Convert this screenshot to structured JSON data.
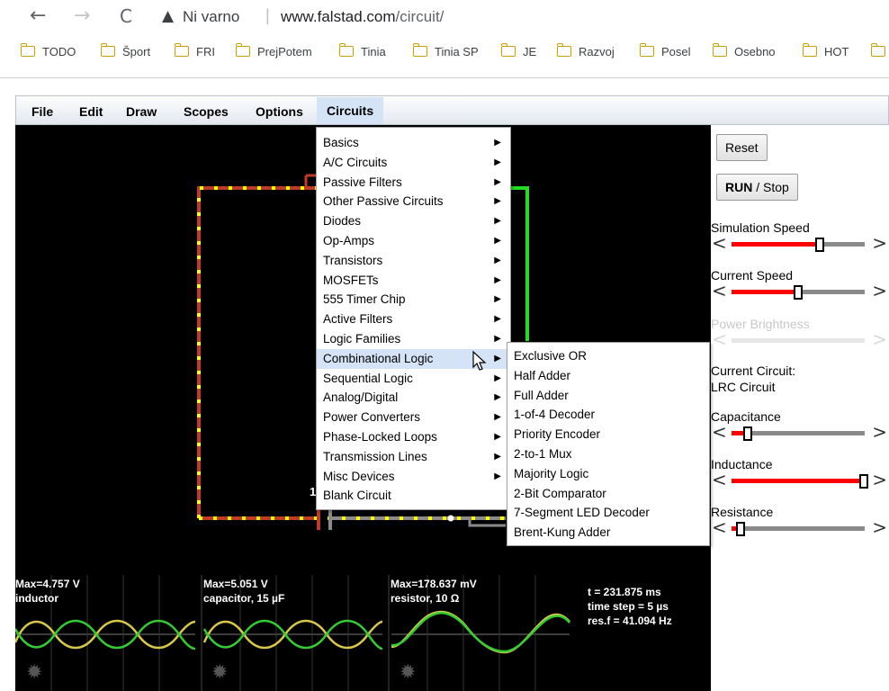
{
  "browser": {
    "back_glyph": "←",
    "forward_glyph": "→",
    "reload_glyph": "C",
    "security_glyph": "▲",
    "security_text": "Ni varno",
    "separator": "|",
    "url_host": "www.falstad.com",
    "url_path": "/circuit/",
    "bookmarks": [
      {
        "label": "TODO"
      },
      {
        "label": "Šport"
      },
      {
        "label": "FRI"
      },
      {
        "label": "PrejPotem"
      },
      {
        "label": "Tinia"
      },
      {
        "label": "Tinia SP"
      },
      {
        "label": "JE"
      },
      {
        "label": "Razvoj"
      },
      {
        "label": "Posel"
      },
      {
        "label": "Osebno"
      },
      {
        "label": "HOT"
      }
    ]
  },
  "menubar": {
    "file": "File",
    "edit": "Edit",
    "draw": "Draw",
    "scopes": "Scopes",
    "options": "Options",
    "circuits": "Circuits"
  },
  "circuits_menu": [
    "Basics",
    "A/C Circuits",
    "Passive Filters",
    "Other Passive Circuits",
    "Diodes",
    "Op-Amps",
    "Transistors",
    "MOSFETs",
    "555 Timer Chip",
    "Active Filters",
    "Logic Families",
    "Combinational Logic",
    "Sequential Logic",
    "Analog/Digital",
    "Power Converters",
    "Phase-Locked Loops",
    "Transmission Lines",
    "Misc Devices",
    "Blank Circuit"
  ],
  "combinational_menu": [
    "Exclusive OR",
    "Half Adder",
    "Full Adder",
    "1-of-4 Decoder",
    "Priority Encoder",
    "2-to-1 Mux",
    "Majority Logic",
    "2-Bit Comparator",
    "7-Segment LED Decoder",
    "Brent-Kung Adder"
  ],
  "sidebar": {
    "reset": "Reset",
    "run": "RUN",
    "stop": " / Stop",
    "sim_speed_label": "Simulation Speed",
    "sim_speed_level": 0.66,
    "current_speed_label": "Current Speed",
    "current_speed_level": 0.5,
    "power_brightness_label": "Power Brightness",
    "current_circuit_label": "Current Circuit:",
    "current_circuit_name": "LRC Circuit",
    "capacitance_label": "Capacitance",
    "capacitance_level": 0.12,
    "inductance_label": "Inductance",
    "inductance_level": 0.99,
    "resistance_label": "Resistance",
    "resistance_level": 0.07,
    "lt": "<",
    "gt": ">"
  },
  "scopes": [
    {
      "max": "Max=4.757 V",
      "name": "inductor"
    },
    {
      "max": "Max=5.051 V",
      "name": "capacitor, 15 µF"
    },
    {
      "max": "Max=178.637 mV",
      "name": "resistor, 10 Ω"
    }
  ],
  "sim_info": {
    "time": "t = 231.875 ms",
    "step": "time step = 5 µs",
    "resf": "res.f = 41.094 Hz"
  },
  "circuit_fragment_label": "1",
  "colors": {
    "wire_red": "#c0392b",
    "wire_green": "#22dd22",
    "current_dot": "#ffff00",
    "scope_yellow": "#d8c84a",
    "scope_green": "#33cc33",
    "slider_fill": "#ff0000",
    "menu_highlight": "#d5e3f7"
  }
}
